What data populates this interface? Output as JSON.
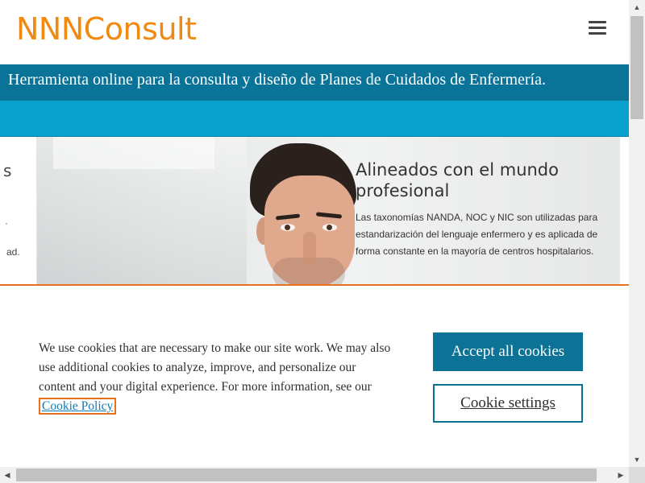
{
  "header": {
    "logo_text": "NNNConsult",
    "menu_icon": "hamburger-menu-icon"
  },
  "banner": {
    "text": "Herramienta online para la consulta y diseño de Planes de Cuidados de Enfermería."
  },
  "carousel": {
    "prev_slide": {
      "fragment_title": "s",
      "fragment_mid": "·",
      "fragment_end": "ad."
    },
    "slide": {
      "title": "Alineados con el mundo profesional",
      "body": "Las taxonomías NANDA, NOC y NIC son utilizadas para estandarización del lenguaje enfermero y es aplicada de forma constante en la mayoría de centros hospitalarios."
    }
  },
  "cookie_banner": {
    "text": "We use cookies that are necessary to make our site work. We may also use additional cookies to analyze, improve, and personalize our content and your digital experience. For more information, see our",
    "link_text": "Cookie Policy",
    "accept_label": "Accept all cookies",
    "settings_label": "Cookie settings"
  },
  "scrollbars": {
    "up_arrow": "▲",
    "down_arrow": "▼",
    "left_arrow": "◀",
    "right_arrow": "▶"
  },
  "colors": {
    "brand_orange": "#f08a12",
    "banner_blue": "#0a7398",
    "subbar_blue": "#0aa0ce",
    "cookie_accent": "#e9711c",
    "button_teal": "#0c7396"
  }
}
